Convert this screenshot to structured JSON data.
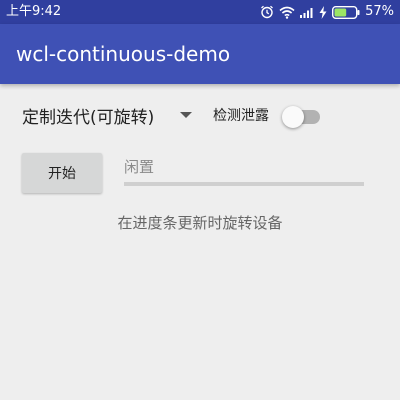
{
  "status_bar": {
    "time": "上午9:42",
    "battery_percent": "57%",
    "icons": [
      "alarm-icon",
      "wifi-icon",
      "signal-icon",
      "charging-icon",
      "battery-icon"
    ],
    "battery_level": 0.57
  },
  "app_bar": {
    "title": "wcl-continuous-demo"
  },
  "controls": {
    "spinner_value": "定制迭代(可旋转)",
    "leak_label": "检测泄露",
    "leak_switch_on": false,
    "start_button": "开始",
    "status": "闲置",
    "progress": 0
  },
  "hint": "在进度条更新时旋转设备",
  "colors": {
    "primary": "#3f51b5",
    "primary_dark": "#303f9f",
    "background": "#eeeeee"
  }
}
